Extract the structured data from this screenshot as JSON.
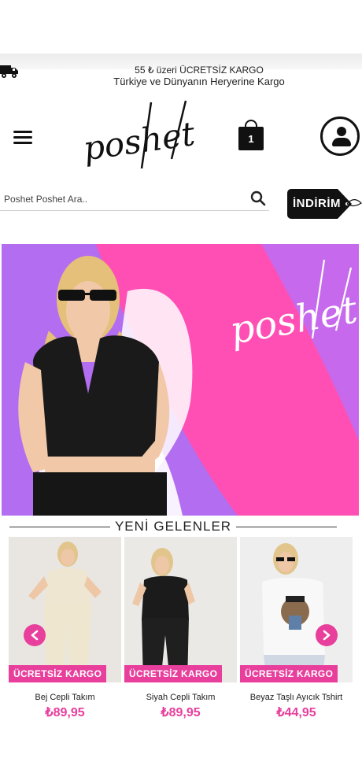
{
  "announcement": {
    "line1": "55 ₺ üzeri ÜCRETSİZ KARGO",
    "line2": "Türkiye ve Dünyanın Heryerine Kargo"
  },
  "header": {
    "logo_text": "poshet",
    "cart_count": "1"
  },
  "search": {
    "placeholder": "Poshet Poshet Ara.."
  },
  "sale_tag": {
    "label": "İNDİRİM"
  },
  "hero": {
    "logo_text": "poshet"
  },
  "new_arrivals": {
    "title": "YENİ GELENLER",
    "products": [
      {
        "badge": "ÜCRETSİZ KARGO",
        "name": "Bej Cepli Takım",
        "price": "₺89,95"
      },
      {
        "badge": "ÜCRETSİZ KARGO",
        "name": "Siyah Cepli Takım",
        "price": "₺89,95"
      },
      {
        "badge": "ÜCRETSİZ KARGO",
        "name": "Beyaz Taşlı Ayıcık Tshirt",
        "price": "₺44,95"
      }
    ]
  },
  "colors": {
    "accent_pink": "#e83e9c",
    "hero_purple": "#b36df0",
    "hero_pink": "#ff4fb4"
  }
}
